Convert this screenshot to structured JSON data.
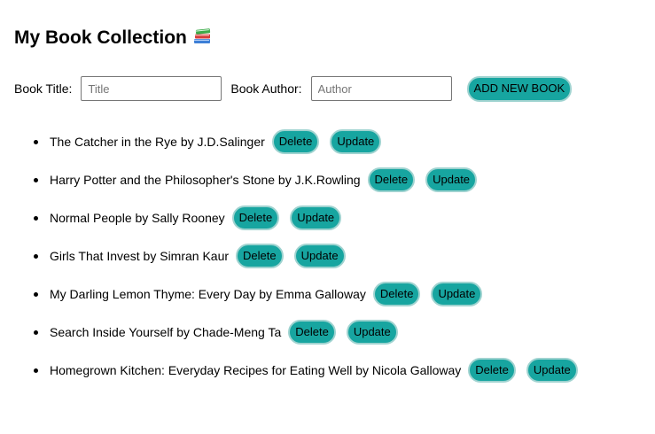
{
  "header": {
    "title": "My Book Collection",
    "title_icon": "books-icon"
  },
  "form": {
    "title_label": "Book Title:",
    "title_placeholder": "Title",
    "title_value": "",
    "author_label": "Book Author:",
    "author_placeholder": "Author",
    "author_value": "",
    "add_label": "ADD NEW BOOK"
  },
  "books": [
    {
      "text": "The Catcher in the Rye by J.D.Salinger",
      "delete_label": "Delete",
      "update_label": "Update"
    },
    {
      "text": "Harry Potter and the Philosopher's Stone by J.K.Rowling",
      "delete_label": "Delete",
      "update_label": "Update"
    },
    {
      "text": "Normal People by Sally Rooney",
      "delete_label": "Delete",
      "update_label": "Update"
    },
    {
      "text": "Girls That Invest by Simran Kaur",
      "delete_label": "Delete",
      "update_label": "Update"
    },
    {
      "text": "My Darling Lemon Thyme: Every Day by Emma Galloway",
      "delete_label": "Delete",
      "update_label": "Update"
    },
    {
      "text": "Search Inside Yourself by Chade-Meng Ta",
      "delete_label": "Delete",
      "update_label": "Update"
    },
    {
      "text": "Homegrown Kitchen: Everyday Recipes for Eating Well by Nicola Galloway",
      "delete_label": "Delete",
      "update_label": "Update"
    }
  ],
  "colors": {
    "button_fill": "#17a5a0",
    "button_border": "#9fd3d0",
    "input_border": "#767676"
  }
}
